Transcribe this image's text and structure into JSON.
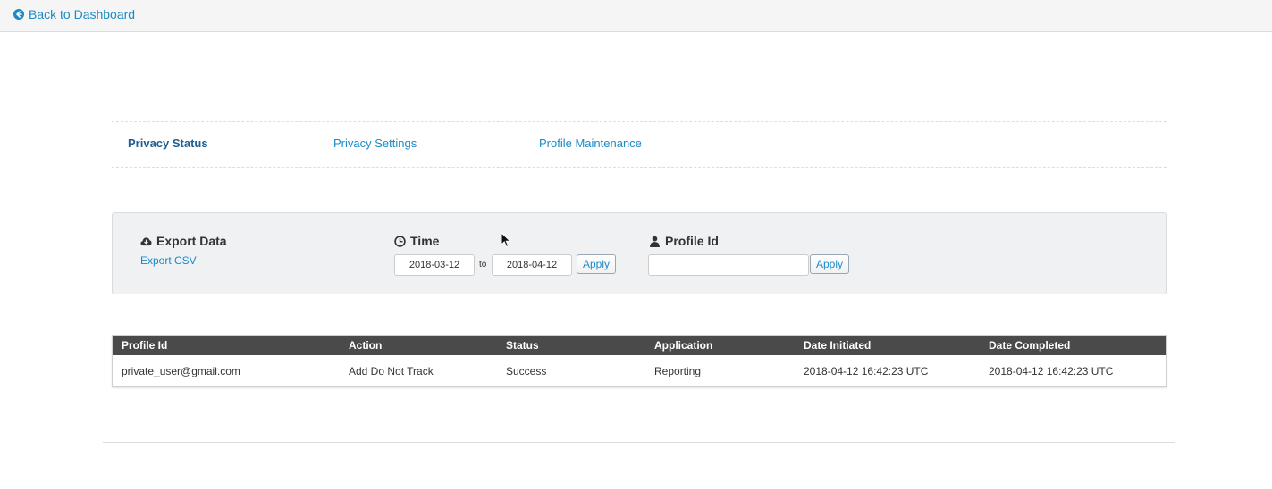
{
  "topbar": {
    "back_label": "Back to Dashboard",
    "back_icon": "circle-arrow-left-icon"
  },
  "tabs": [
    {
      "label": "Privacy Status",
      "active": true
    },
    {
      "label": "Privacy Settings",
      "active": false
    },
    {
      "label": "Profile Maintenance",
      "active": false
    }
  ],
  "filters": {
    "export": {
      "title": "Export Data",
      "icon": "cloud-download-icon",
      "link_label": "Export CSV"
    },
    "time": {
      "title": "Time",
      "icon": "clock-icon",
      "from_value": "2018-03-12",
      "to_label": "to",
      "to_value": "2018-04-12",
      "apply_label": "Apply"
    },
    "profile": {
      "title": "Profile Id",
      "icon": "user-icon",
      "value": "",
      "apply_label": "Apply"
    }
  },
  "table": {
    "columns": [
      "Profile Id",
      "Action",
      "Status",
      "Application",
      "Date Initiated",
      "Date Completed"
    ],
    "rows": [
      [
        "private_user@gmail.com",
        "Add Do Not Track",
        "Success",
        "Reporting",
        "2018-04-12 16:42:23 UTC",
        "2018-04-12 16:42:23 UTC"
      ]
    ]
  },
  "colors": {
    "link": "#1a8bc6",
    "active_tab": "#1f5f93",
    "table_header_bg": "#4a4a4a",
    "panel_bg": "#eff1f3"
  }
}
